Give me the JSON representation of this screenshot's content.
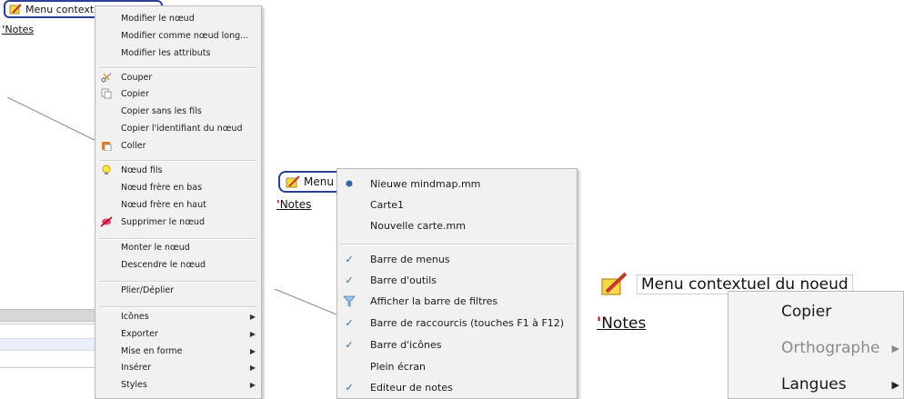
{
  "panel1": {
    "node_label": "Menu contextuel du nœud",
    "notes_label": "Notes",
    "menu": [
      {
        "label": "Modifier le nœud",
        "icon": ""
      },
      {
        "label": "Modifier comme nœud long...",
        "icon": ""
      },
      {
        "label": "Modifier les attributs",
        "icon": ""
      },
      {
        "label": "Couper",
        "icon": "scissors-icon"
      },
      {
        "label": "Copier",
        "icon": "copy-icon"
      },
      {
        "label": "Copier sans les fils",
        "icon": ""
      },
      {
        "label": "Copier l'identifiant du nœud",
        "icon": ""
      },
      {
        "label": "Coller",
        "icon": "paste-icon"
      },
      {
        "label": "Nœud fils",
        "icon": "bulb-icon"
      },
      {
        "label": "Nœud frère en bas",
        "icon": ""
      },
      {
        "label": "Nœud frère en haut",
        "icon": ""
      },
      {
        "label": "Supprimer le nœud",
        "icon": "delete-node-icon"
      },
      {
        "label": "Monter le nœud",
        "icon": ""
      },
      {
        "label": "Descendre le nœud",
        "icon": ""
      },
      {
        "label": "Plier/Déplier",
        "icon": ""
      },
      {
        "label": "Icônes",
        "icon": "",
        "submenu": true
      },
      {
        "label": "Exporter",
        "icon": "",
        "submenu": true
      },
      {
        "label": "Mise en forme",
        "icon": "",
        "submenu": true
      },
      {
        "label": "Insérer",
        "icon": "",
        "submenu": true
      },
      {
        "label": "Styles",
        "icon": "",
        "submenu": true
      }
    ]
  },
  "panel2": {
    "node_label": "Menu",
    "notes_label": "Notes",
    "menu": [
      {
        "label": "Nieuwe mindmap.mm",
        "mark": "radio"
      },
      {
        "label": "Carte1",
        "mark": ""
      },
      {
        "label": "Nouvelle carte.mm",
        "mark": ""
      },
      {
        "label": "Barre de menus",
        "mark": "check"
      },
      {
        "label": "Barre d'outils",
        "mark": "check"
      },
      {
        "label": "Afficher la barre de filtres",
        "mark": "filter"
      },
      {
        "label": "Barre de raccourcis (touches F1 à F12)",
        "mark": "check"
      },
      {
        "label": "Barre d'icônes",
        "mark": "check"
      },
      {
        "label": "Plein écran",
        "mark": ""
      },
      {
        "label": "Editeur de notes",
        "mark": "check"
      }
    ]
  },
  "panel3": {
    "node_label": "Menu contextuel du noeud",
    "notes_label": "Notes",
    "menu": [
      {
        "label": "Copier",
        "disabled": false,
        "submenu": false
      },
      {
        "label": "Orthographe",
        "disabled": true,
        "submenu": true
      },
      {
        "label": "Langues",
        "disabled": false,
        "submenu": true
      }
    ]
  },
  "colors": {
    "accent": "#2b3f96",
    "menu_bg": "#f1f1f1",
    "check": "#3465a4",
    "disabled": "#8a8a8a"
  }
}
